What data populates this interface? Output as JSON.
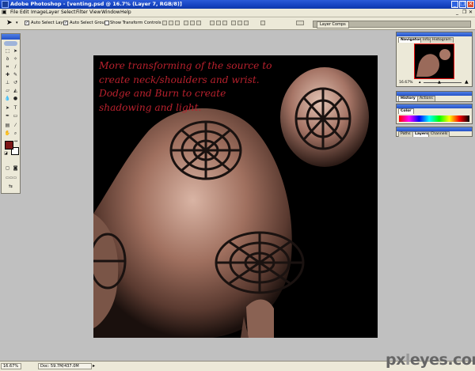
{
  "window": {
    "title": "Adobe Photoshop - [venting.psd @ 16.7% (Layer 7, RGB/8)]",
    "minimize": "_",
    "restore": "❐",
    "close": "✕"
  },
  "menu": [
    "File",
    "Edit",
    "Image",
    "Layer",
    "Select",
    "Filter",
    "View",
    "Window",
    "Help"
  ],
  "options_bar": {
    "auto_select_layer": "Auto Select Layer",
    "auto_select_groups": "Auto Select Groups",
    "show_transform_controls": "Show Transform Controls",
    "palette_well_tab": "Layer Comps"
  },
  "canvas": {
    "text": "More transforming of the source to create neck/shoulders and wrist. Dodge and Burn to create shadowing and light."
  },
  "navigator": {
    "tabs": [
      "Navigator",
      "Info",
      "Histogram"
    ],
    "zoom": "16.67%"
  },
  "history": {
    "tabs": [
      "History",
      "Actions"
    ]
  },
  "color": {
    "tabs": [
      "Color"
    ]
  },
  "layers": {
    "tabs": [
      "Paths",
      "Layers",
      "Channels"
    ]
  },
  "status": {
    "zoom": "16.67%",
    "doc": "Doc: 59.7M/437.0M"
  },
  "colors": {
    "foreground": "#7d1616",
    "background": "#ffffff",
    "text_red": "#b8212d"
  },
  "watermark": {
    "text": "pxleyes.com"
  }
}
